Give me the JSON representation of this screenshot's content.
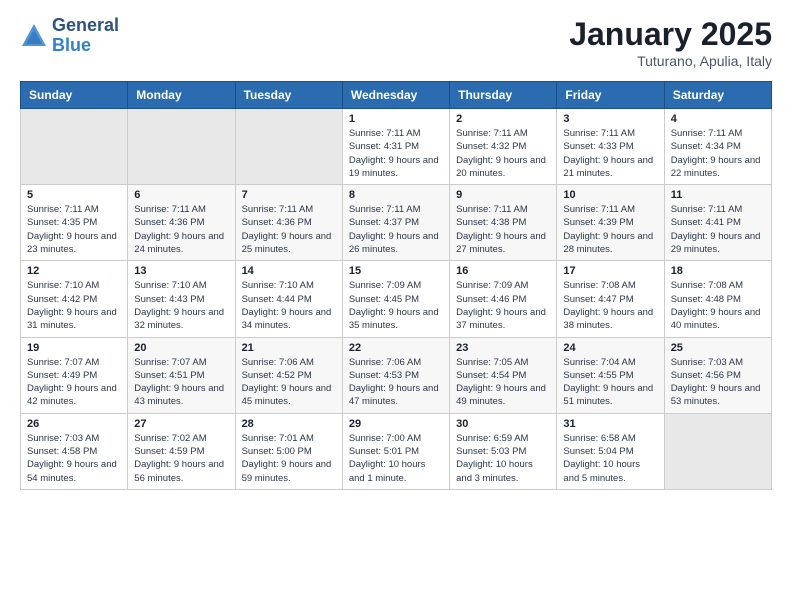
{
  "header": {
    "logo_general": "General",
    "logo_blue": "Blue",
    "month_title": "January 2025",
    "location": "Tuturano, Apulia, Italy"
  },
  "weekdays": [
    "Sunday",
    "Monday",
    "Tuesday",
    "Wednesday",
    "Thursday",
    "Friday",
    "Saturday"
  ],
  "weeks": [
    [
      {
        "day": "",
        "sunrise": "",
        "sunset": "",
        "daylight": ""
      },
      {
        "day": "",
        "sunrise": "",
        "sunset": "",
        "daylight": ""
      },
      {
        "day": "",
        "sunrise": "",
        "sunset": "",
        "daylight": ""
      },
      {
        "day": "1",
        "sunrise": "Sunrise: 7:11 AM",
        "sunset": "Sunset: 4:31 PM",
        "daylight": "Daylight: 9 hours and 19 minutes."
      },
      {
        "day": "2",
        "sunrise": "Sunrise: 7:11 AM",
        "sunset": "Sunset: 4:32 PM",
        "daylight": "Daylight: 9 hours and 20 minutes."
      },
      {
        "day": "3",
        "sunrise": "Sunrise: 7:11 AM",
        "sunset": "Sunset: 4:33 PM",
        "daylight": "Daylight: 9 hours and 21 minutes."
      },
      {
        "day": "4",
        "sunrise": "Sunrise: 7:11 AM",
        "sunset": "Sunset: 4:34 PM",
        "daylight": "Daylight: 9 hours and 22 minutes."
      }
    ],
    [
      {
        "day": "5",
        "sunrise": "Sunrise: 7:11 AM",
        "sunset": "Sunset: 4:35 PM",
        "daylight": "Daylight: 9 hours and 23 minutes."
      },
      {
        "day": "6",
        "sunrise": "Sunrise: 7:11 AM",
        "sunset": "Sunset: 4:36 PM",
        "daylight": "Daylight: 9 hours and 24 minutes."
      },
      {
        "day": "7",
        "sunrise": "Sunrise: 7:11 AM",
        "sunset": "Sunset: 4:36 PM",
        "daylight": "Daylight: 9 hours and 25 minutes."
      },
      {
        "day": "8",
        "sunrise": "Sunrise: 7:11 AM",
        "sunset": "Sunset: 4:37 PM",
        "daylight": "Daylight: 9 hours and 26 minutes."
      },
      {
        "day": "9",
        "sunrise": "Sunrise: 7:11 AM",
        "sunset": "Sunset: 4:38 PM",
        "daylight": "Daylight: 9 hours and 27 minutes."
      },
      {
        "day": "10",
        "sunrise": "Sunrise: 7:11 AM",
        "sunset": "Sunset: 4:39 PM",
        "daylight": "Daylight: 9 hours and 28 minutes."
      },
      {
        "day": "11",
        "sunrise": "Sunrise: 7:11 AM",
        "sunset": "Sunset: 4:41 PM",
        "daylight": "Daylight: 9 hours and 29 minutes."
      }
    ],
    [
      {
        "day": "12",
        "sunrise": "Sunrise: 7:10 AM",
        "sunset": "Sunset: 4:42 PM",
        "daylight": "Daylight: 9 hours and 31 minutes."
      },
      {
        "day": "13",
        "sunrise": "Sunrise: 7:10 AM",
        "sunset": "Sunset: 4:43 PM",
        "daylight": "Daylight: 9 hours and 32 minutes."
      },
      {
        "day": "14",
        "sunrise": "Sunrise: 7:10 AM",
        "sunset": "Sunset: 4:44 PM",
        "daylight": "Daylight: 9 hours and 34 minutes."
      },
      {
        "day": "15",
        "sunrise": "Sunrise: 7:09 AM",
        "sunset": "Sunset: 4:45 PM",
        "daylight": "Daylight: 9 hours and 35 minutes."
      },
      {
        "day": "16",
        "sunrise": "Sunrise: 7:09 AM",
        "sunset": "Sunset: 4:46 PM",
        "daylight": "Daylight: 9 hours and 37 minutes."
      },
      {
        "day": "17",
        "sunrise": "Sunrise: 7:08 AM",
        "sunset": "Sunset: 4:47 PM",
        "daylight": "Daylight: 9 hours and 38 minutes."
      },
      {
        "day": "18",
        "sunrise": "Sunrise: 7:08 AM",
        "sunset": "Sunset: 4:48 PM",
        "daylight": "Daylight: 9 hours and 40 minutes."
      }
    ],
    [
      {
        "day": "19",
        "sunrise": "Sunrise: 7:07 AM",
        "sunset": "Sunset: 4:49 PM",
        "daylight": "Daylight: 9 hours and 42 minutes."
      },
      {
        "day": "20",
        "sunrise": "Sunrise: 7:07 AM",
        "sunset": "Sunset: 4:51 PM",
        "daylight": "Daylight: 9 hours and 43 minutes."
      },
      {
        "day": "21",
        "sunrise": "Sunrise: 7:06 AM",
        "sunset": "Sunset: 4:52 PM",
        "daylight": "Daylight: 9 hours and 45 minutes."
      },
      {
        "day": "22",
        "sunrise": "Sunrise: 7:06 AM",
        "sunset": "Sunset: 4:53 PM",
        "daylight": "Daylight: 9 hours and 47 minutes."
      },
      {
        "day": "23",
        "sunrise": "Sunrise: 7:05 AM",
        "sunset": "Sunset: 4:54 PM",
        "daylight": "Daylight: 9 hours and 49 minutes."
      },
      {
        "day": "24",
        "sunrise": "Sunrise: 7:04 AM",
        "sunset": "Sunset: 4:55 PM",
        "daylight": "Daylight: 9 hours and 51 minutes."
      },
      {
        "day": "25",
        "sunrise": "Sunrise: 7:03 AM",
        "sunset": "Sunset: 4:56 PM",
        "daylight": "Daylight: 9 hours and 53 minutes."
      }
    ],
    [
      {
        "day": "26",
        "sunrise": "Sunrise: 7:03 AM",
        "sunset": "Sunset: 4:58 PM",
        "daylight": "Daylight: 9 hours and 54 minutes."
      },
      {
        "day": "27",
        "sunrise": "Sunrise: 7:02 AM",
        "sunset": "Sunset: 4:59 PM",
        "daylight": "Daylight: 9 hours and 56 minutes."
      },
      {
        "day": "28",
        "sunrise": "Sunrise: 7:01 AM",
        "sunset": "Sunset: 5:00 PM",
        "daylight": "Daylight: 9 hours and 59 minutes."
      },
      {
        "day": "29",
        "sunrise": "Sunrise: 7:00 AM",
        "sunset": "Sunset: 5:01 PM",
        "daylight": "Daylight: 10 hours and 1 minute."
      },
      {
        "day": "30",
        "sunrise": "Sunrise: 6:59 AM",
        "sunset": "Sunset: 5:03 PM",
        "daylight": "Daylight: 10 hours and 3 minutes."
      },
      {
        "day": "31",
        "sunrise": "Sunrise: 6:58 AM",
        "sunset": "Sunset: 5:04 PM",
        "daylight": "Daylight: 10 hours and 5 minutes."
      },
      {
        "day": "",
        "sunrise": "",
        "sunset": "",
        "daylight": ""
      }
    ]
  ]
}
